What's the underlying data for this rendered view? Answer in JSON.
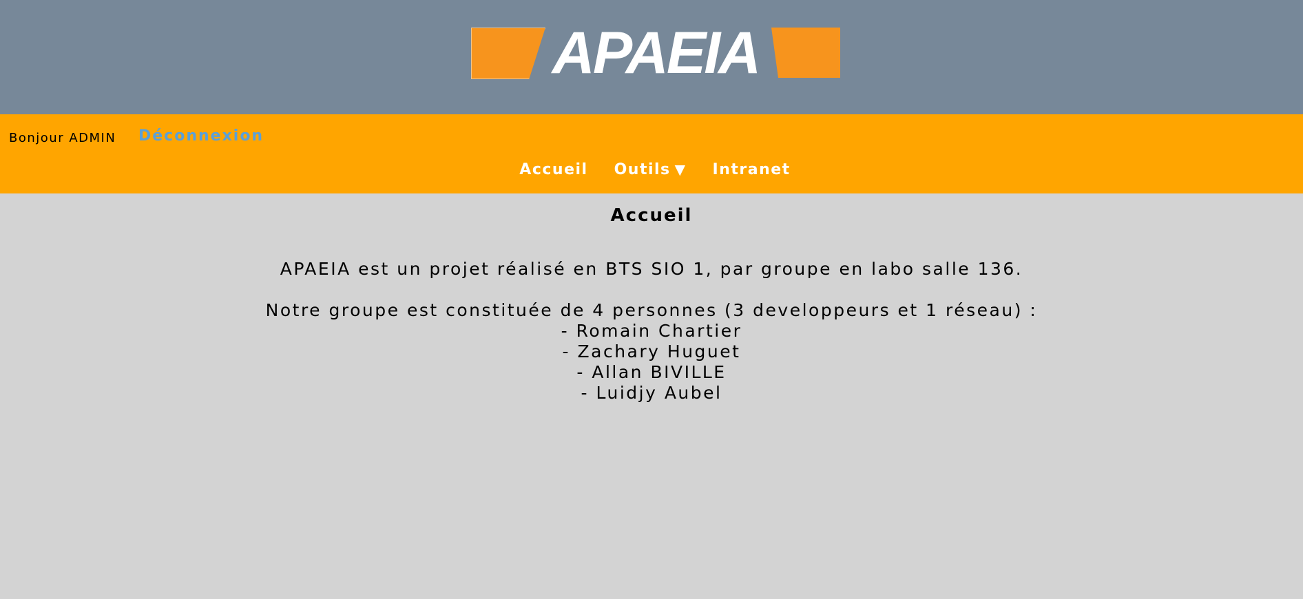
{
  "header": {
    "logo_text": "APAEIA",
    "background_color": "#778899",
    "logo_accent_color": "#f7941d"
  },
  "navbar": {
    "background_color": "#ffa500",
    "greeting": "Bonjour ADMIN",
    "logout_label": "Déconnexion",
    "logout_color": "#5aa0d8",
    "menu": [
      {
        "label": "Accueil"
      },
      {
        "label": "Outils",
        "icon": "dropdown-triangle-icon",
        "glyph": "▼"
      },
      {
        "label": "Intranet"
      }
    ]
  },
  "main": {
    "title": "Accueil",
    "intro": "APAEIA est un projet réalisé en BTS SIO 1, par groupe en labo salle 136.",
    "group_description": "Notre groupe est constituée de 4 personnes (3 developpeurs et 1 réseau) :",
    "members": [
      "- Romain Chartier",
      "- Zachary Huguet",
      "- Allan BIVILLE",
      "- Luidjy Aubel"
    ],
    "background_color": "#d3d3d3"
  }
}
